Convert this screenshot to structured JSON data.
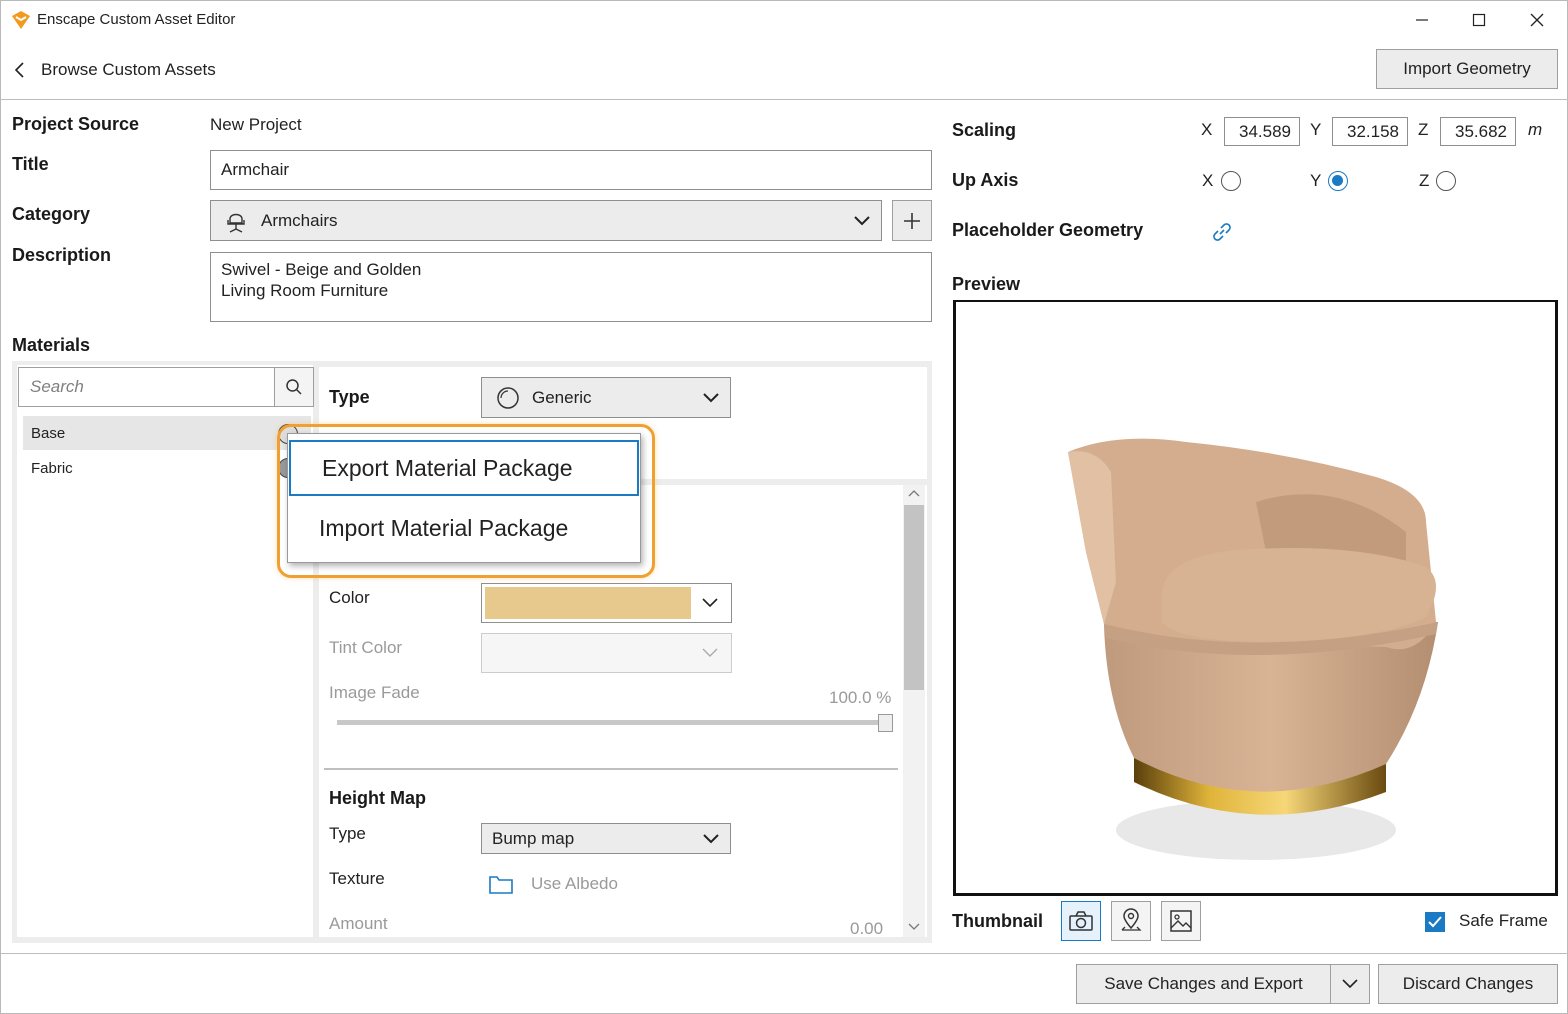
{
  "window": {
    "title": "Enscape Custom Asset Editor"
  },
  "header": {
    "back_label": "Browse Custom Assets",
    "import_geometry_label": "Import Geometry"
  },
  "project": {
    "source_label": "Project Source",
    "source_value": "New Project",
    "title_label": "Title",
    "title_value": "Armchair",
    "category_label": "Category",
    "category_value": "Armchairs",
    "description_label": "Description",
    "description_line1": "Swivel - Beige and Golden",
    "description_line2": "Living Room Furniture"
  },
  "materials": {
    "heading": "Materials",
    "search_placeholder": "Search",
    "items": [
      "Base",
      "Fabric"
    ],
    "type_label": "Type",
    "type_value": "Generic",
    "color_label": "Color",
    "color_swatch": "#e8c98d",
    "tint_label": "Tint Color",
    "image_fade_label": "Image Fade",
    "image_fade_value": "100.0 %",
    "image_fade_fraction": 1.0,
    "height_map_heading": "Height Map",
    "hm_type_label": "Type",
    "hm_type_value": "Bump map",
    "hm_texture_label": "Texture",
    "hm_texture_value": "Use Albedo",
    "hm_amount_label": "Amount",
    "hm_amount_value": "0.00"
  },
  "context_menu": {
    "items": [
      "Export Material Package",
      "Import Material Package"
    ]
  },
  "transform": {
    "scaling_label": "Scaling",
    "x_label": "X",
    "x_value": "34.589",
    "y_label": "Y",
    "y_value": "32.158",
    "z_label": "Z",
    "z_value": "35.682",
    "unit": "m",
    "up_axis_label": "Up Axis",
    "up_axis_options": [
      "X",
      "Y",
      "Z"
    ],
    "up_axis_selected": "Y",
    "placeholder_label": "Placeholder Geometry"
  },
  "preview": {
    "label": "Preview",
    "thumbnail_label": "Thumbnail",
    "safe_frame_label": "Safe Frame",
    "safe_frame_checked": true
  },
  "footer": {
    "save_label": "Save Changes and Export",
    "discard_label": "Discard Changes"
  },
  "colors": {
    "accent": "#1a7bc4",
    "highlight": "#f0a030",
    "chair_fabric": "#d2ab8c",
    "chair_base": "#c89a2a"
  }
}
